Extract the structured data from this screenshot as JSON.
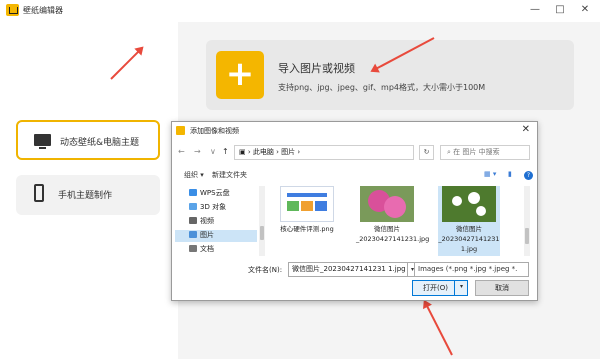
{
  "app": {
    "title": "壁纸编辑器",
    "window_buttons": [
      "—",
      "□",
      "✕"
    ]
  },
  "sidebar": {
    "items": [
      {
        "label": "动态壁纸&电脑主题",
        "icon": "monitor-icon",
        "active": true
      },
      {
        "label": "手机主题制作",
        "icon": "phone-icon",
        "active": false
      }
    ]
  },
  "import": {
    "title": "导入图片或视频",
    "subtitle": "支持png、jpg、jpeg、gif、mp4格式，大小需小于100M",
    "icon": "plus-icon",
    "accent": "#f4b600"
  },
  "dialog": {
    "title": "添加图像和视频",
    "nav_back": "←",
    "nav_forward": "→",
    "nav_down": "∨",
    "nav_up": "↑",
    "breadcrumb": "▣ › 此电脑 › 图片 ›",
    "refresh": "↻",
    "search_placeholder": "⌕ 在 图片 中搜索",
    "toolbar": {
      "organize": "组织 ▾",
      "new_folder": "新建文件夹",
      "view": "▦ ▾",
      "pane": "▮",
      "help": "?"
    },
    "nav_items": [
      {
        "label": "WPS云盘",
        "color": "#3a8ee6"
      },
      {
        "label": "3D 对象",
        "color": "#5aa3e8"
      },
      {
        "label": "视频",
        "color": "#666666"
      },
      {
        "label": "图片",
        "color": "#4a90d9",
        "selected": true
      },
      {
        "label": "文档",
        "color": "#777777"
      }
    ],
    "files": [
      {
        "name": "核心硬件评测.png",
        "selected": false
      },
      {
        "name": "微信图片_20230427141231.jpg",
        "selected": false
      },
      {
        "name": "微信图片_20230427141231 1.jpg",
        "selected": true
      }
    ],
    "filename_label": "文件名(N):",
    "filename_value": "微信图片_20230427141231 1.jpg",
    "filter": "Images (*.png *.jpg *.jpeg *.",
    "open_label": "打开(O)",
    "cancel_label": "取消"
  },
  "annotation_color": "#e84a3c"
}
